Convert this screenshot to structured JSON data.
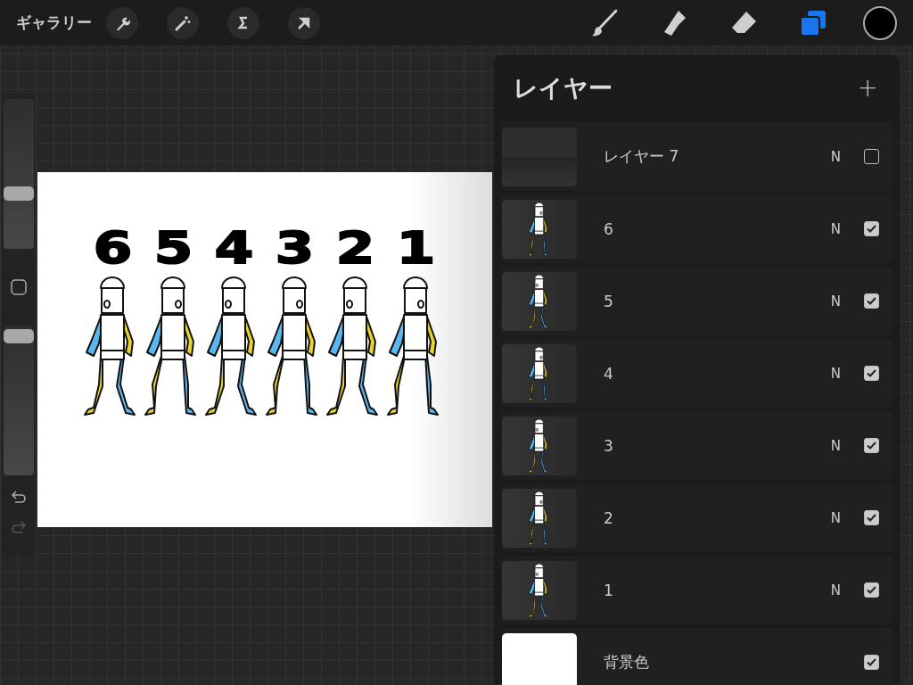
{
  "toolbar": {
    "gallery": "ギャラリー",
    "tools": [
      {
        "kind": "brush",
        "selected": false
      },
      {
        "kind": "smudge",
        "selected": false
      },
      {
        "kind": "eraser",
        "selected": false
      },
      {
        "kind": "layers",
        "selected": true
      }
    ],
    "color": "#000000"
  },
  "sidebar": {
    "brush_size": {
      "level": 0.37
    },
    "opacity": {
      "level": 0.93
    }
  },
  "canvas": {
    "frames": [
      {
        "label": "6"
      },
      {
        "label": "5"
      },
      {
        "label": "4"
      },
      {
        "label": "3"
      },
      {
        "label": "2"
      },
      {
        "label": "1"
      }
    ]
  },
  "layers_panel": {
    "title": "レイヤー",
    "add": "+",
    "layers": [
      {
        "kind": "empty",
        "name": "レイヤー 7",
        "blend": "N",
        "visible": false
      },
      {
        "kind": "figure",
        "name": "6",
        "blend": "N",
        "visible": true
      },
      {
        "kind": "figure",
        "name": "5",
        "blend": "N",
        "visible": true
      },
      {
        "kind": "figure",
        "name": "4",
        "blend": "N",
        "visible": true
      },
      {
        "kind": "figure",
        "name": "3",
        "blend": "N",
        "visible": true
      },
      {
        "kind": "figure",
        "name": "2",
        "blend": "N",
        "visible": true
      },
      {
        "kind": "figure",
        "name": "1",
        "blend": "N",
        "visible": true
      },
      {
        "kind": "background",
        "name": "背景色",
        "visible": true
      }
    ]
  }
}
